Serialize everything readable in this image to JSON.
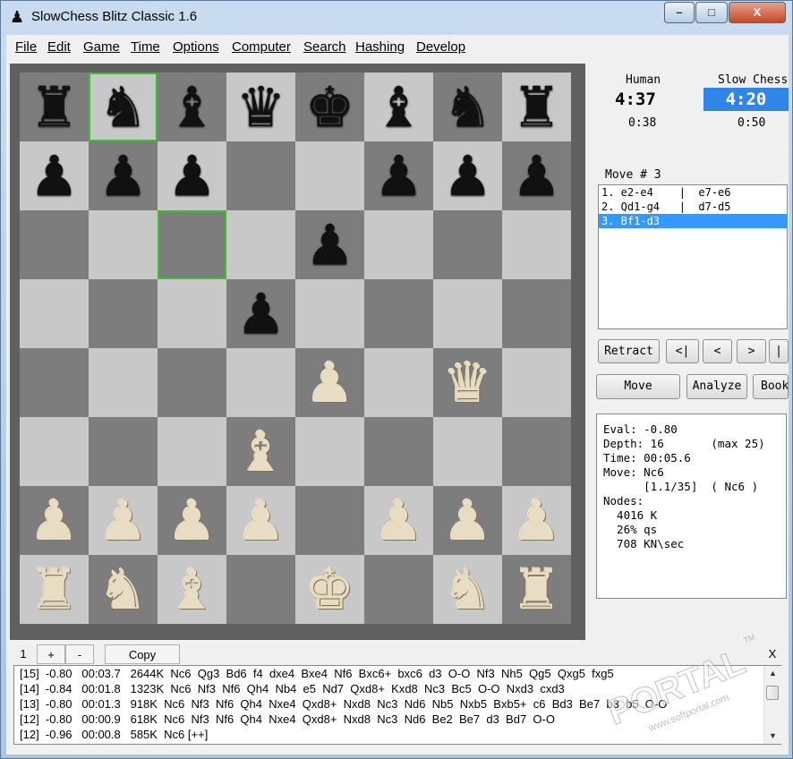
{
  "window": {
    "title": "SlowChess Blitz Classic 1.6",
    "icon": "pawn-icon",
    "controls": {
      "minimize": "–",
      "maximize": "□",
      "close": "X"
    }
  },
  "menu": [
    "File",
    "Edit",
    "Game",
    "Time",
    "Options",
    "Computer",
    "Search",
    "Hashing",
    "Develop"
  ],
  "board": {
    "rows": [
      [
        "r",
        "n",
        "b",
        "q",
        "k",
        "b",
        "n",
        "r"
      ],
      [
        "p",
        "p",
        "p",
        "",
        "",
        "p",
        "p",
        "p"
      ],
      [
        "",
        "",
        "",
        "",
        "p",
        "",
        "",
        ""
      ],
      [
        "",
        "",
        "",
        "p",
        "",
        "",
        "",
        ""
      ],
      [
        "",
        "",
        "",
        "",
        "P",
        "",
        "Q",
        ""
      ],
      [
        "",
        "",
        "",
        "B",
        "",
        "",
        "",
        ""
      ],
      [
        "P",
        "P",
        "P",
        "P",
        "",
        "P",
        "P",
        "P"
      ],
      [
        "R",
        "N",
        "B",
        "",
        "K",
        "",
        "N",
        "R"
      ]
    ],
    "highlight_squares": [
      "b8",
      "c6"
    ],
    "highlight_color": "#39c030"
  },
  "clocks": {
    "human": {
      "name": "Human",
      "time": "4:37",
      "sub": "0:38"
    },
    "engine": {
      "name": "Slow Chess",
      "time": "4:20",
      "sub": "0:50"
    }
  },
  "moves": {
    "header": "Move # 3",
    "rows": [
      "1. e2-e4    |  e7-e6",
      "2. Qd1-g4   |  d7-d5",
      "3. Bf1-d3"
    ],
    "selected_index": 2
  },
  "nav_buttons": [
    "Retract",
    "<|",
    "<",
    ">",
    "|"
  ],
  "action_buttons": [
    "Move",
    "Analyze",
    "Book"
  ],
  "analysis": {
    "lines": [
      "Eval: -0.80",
      "Depth: 16       (max 25)",
      "Time: 00:05.6",
      "Move: Nc6",
      "      [1.1/35]  ( Nc6 )",
      "Nodes:",
      "  4016 K",
      "  26% qs",
      "  708 KN\\sec"
    ]
  },
  "bottom_tabs": {
    "page": "1",
    "plus": "+",
    "minus": "-",
    "copy": "Copy",
    "close": "X"
  },
  "pv_lines": [
    "[15]  -0.80   00:03.7   2644K  Nc6  Qg3  Bd6  f4  dxe4  Bxe4  Nf6  Bxc6+  bxc6  d3  O-O  Nf3  Nh5  Qg5  Qxg5  fxg5",
    "[14]  -0.84   00:01.8   1323K  Nc6  Nf3  Nf6  Qh4  Nb4  e5  Nd7  Qxd8+  Kxd8  Nc3  Bc5  O-O  Nxd3  cxd3",
    "[13]  -0.80   00:01.3   918K  Nc6  Nf3  Nf6  Qh4  Nxe4  Qxd8+  Nxd8  Nc3  Nd6  Nb5  Nxb5  Bxb5+  c6  Bd3  Be7  b3  b5  O-O",
    "[12]  -0.80   00:00.9   618K  Nc6  Nf3  Nf6  Qh4  Nxe4  Qxd8+  Nxd8  Nc3  Nd6  Be2  Be7  d3  Bd7  O-O",
    "[12]  -0.96   00:00.8   585K  Nc6 [++]"
  ],
  "watermark": {
    "text": "PORTAL",
    "url": "www.softportal.com",
    "tm": "TM"
  }
}
